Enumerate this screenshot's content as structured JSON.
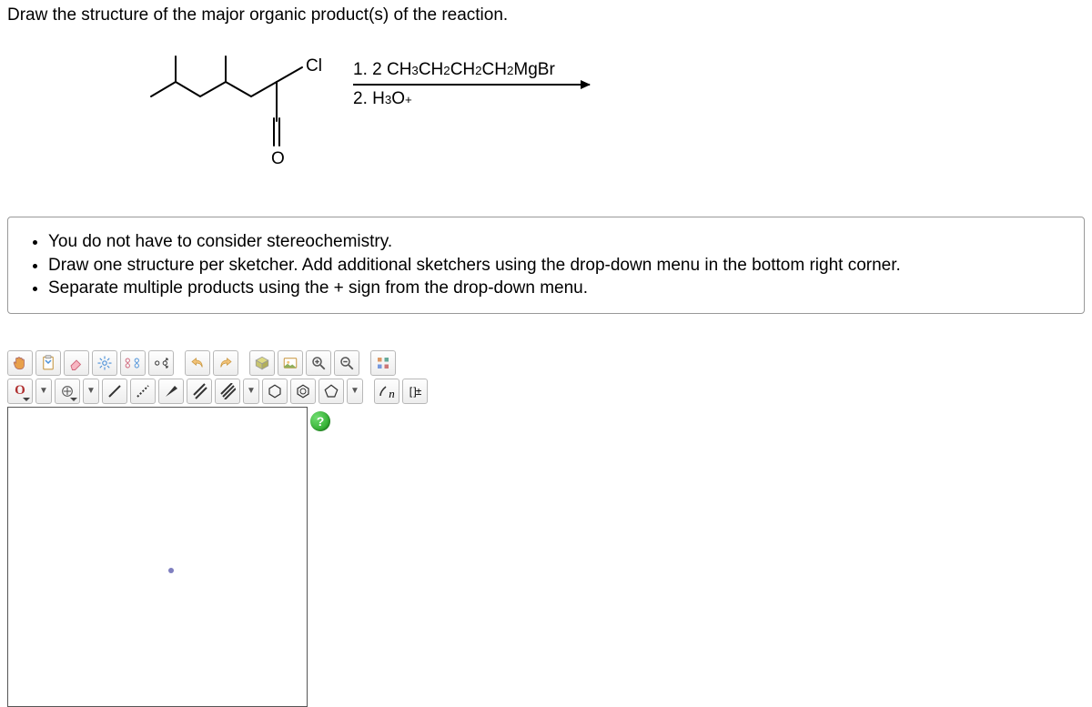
{
  "question": {
    "title": "Draw the structure of the major organic product(s) of the reaction."
  },
  "reaction": {
    "substituent_label": "Cl",
    "oxygen_label": "O",
    "reagent1_prefix": "1. 2 CH",
    "reagent1_sub1": "3",
    "reagent1_mid1": "CH",
    "reagent1_sub2": "2",
    "reagent1_mid2": "CH",
    "reagent1_sub3": "2",
    "reagent1_mid3": "CH",
    "reagent1_sub4": "2",
    "reagent1_tail": "MgBr",
    "reagent2_prefix": "2. H",
    "reagent2_sub": "3",
    "reagent2_o": "O",
    "reagent2_sup": "+"
  },
  "instructions": {
    "items": [
      "You do not have to consider stereochemistry.",
      "Draw one structure per sketcher. Add additional sketchers using the drop-down menu in the bottom right corner.",
      "Separate multiple products using the + sign from the drop-down menu."
    ]
  },
  "toolbar": {
    "element_label": "O",
    "sn_label": "n",
    "charge_label": "[ ]±",
    "help_label": "?"
  },
  "chart_data": {
    "type": "table",
    "title": "UI controls (not a data chart)"
  }
}
